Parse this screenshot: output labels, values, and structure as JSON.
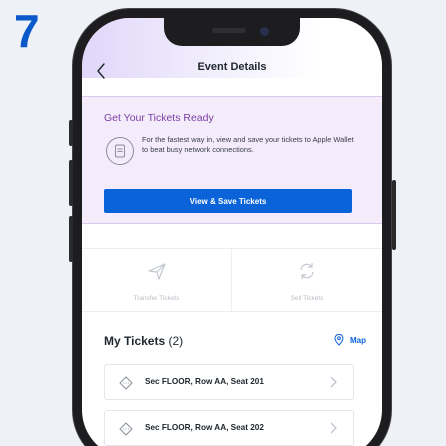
{
  "step": {
    "number": "7"
  },
  "nav": {
    "title": "Event Details"
  },
  "ready": {
    "title": "Get Your Tickets Ready",
    "text": "For the fastest way in, view and save your tickets to Apple Wallet to beat busy network connections.",
    "button": "View & Save Tickets"
  },
  "actions": [
    {
      "label": "Transfer Tickets",
      "icon": "paper-plane-icon"
    },
    {
      "label": "Sell Tickets",
      "icon": "sell-refresh-icon"
    }
  ],
  "tickets": {
    "title": "My Tickets",
    "count": "(2)",
    "map_label": "Map",
    "items": [
      {
        "label": "Sec FLOOR, Row AA, Seat 201"
      },
      {
        "label": "Sec FLOOR, Row AA, Seat 202"
      }
    ]
  },
  "colors": {
    "brand_blue": "#0b63d9",
    "purple_title": "#7a3fa5",
    "card_bg": "#f4ebfb",
    "step_blue": "#0b59c9"
  }
}
